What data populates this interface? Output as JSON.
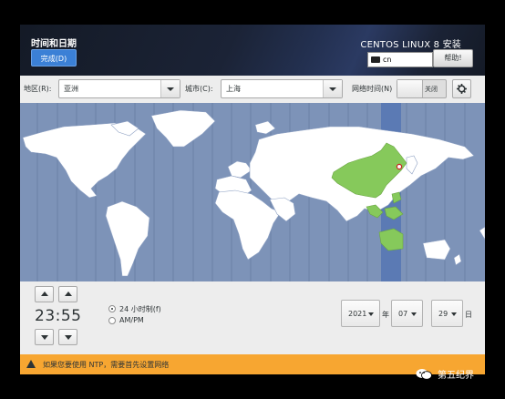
{
  "header": {
    "title": "时间和日期",
    "done_label": "完成(D)",
    "product": "CENTOS LINUX 8 安装",
    "keyboard_layout": "cn",
    "help_label": "帮助!"
  },
  "toolbar": {
    "region_label": "地区(R):",
    "region_value": "亚洲",
    "city_label": "城市(C):",
    "city_value": "上海",
    "ntp_label": "网络时间(N)",
    "ntp_state": "关闭"
  },
  "map": {
    "selected_city": "上海",
    "timezone_band_color": "#5b7ab4",
    "highlight_color": "#86c95b",
    "ocean_color": "#7d93b8"
  },
  "clock": {
    "time": "23:55",
    "format_24h_label": "24 小时制(f)",
    "format_ampm_label": "AM/PM",
    "format_selected": "24h"
  },
  "date": {
    "year": "2021",
    "year_suffix": "年",
    "month": "07",
    "day": "29",
    "day_suffix": "日"
  },
  "warning": {
    "text": "如果您要使用 NTP，需要首先设置网络"
  },
  "watermark": {
    "text": "第五纪界"
  }
}
